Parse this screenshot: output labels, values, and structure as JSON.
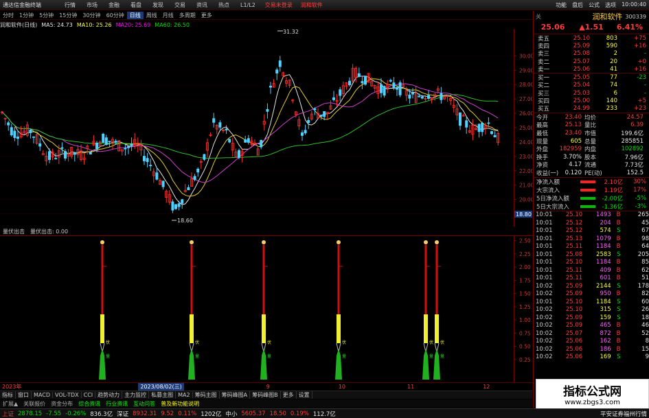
{
  "menubar": {
    "app_title": "通达信金融终端",
    "items": [
      "行情",
      "市场",
      "金融",
      "看盘",
      "发现",
      "交易",
      "资讯",
      "热点",
      "L1/L2"
    ],
    "login": "交易未登录",
    "login2": "润和软件",
    "right": [
      "功能",
      "盘后",
      "公式",
      "选项",
      "10:00:40"
    ]
  },
  "periods": [
    "分时",
    "1分钟",
    "5分钟",
    "15分钟",
    "30分钟",
    "60分钟",
    "日线",
    "周线",
    "月线",
    "多周期",
    "更多"
  ],
  "active_period": "日线",
  "ma": {
    "title": "润和软件(日线)",
    "ma5": "MA5: 24.73",
    "ma10": "MA10: 25.26",
    "ma20": "MA20: 25.69",
    "ma60": "MA60: 26.50"
  },
  "price_axis": [
    "30.00",
    "29.00",
    "28.00",
    "27.00",
    "26.00",
    "25.00",
    "24.00",
    "23.00",
    "22.00",
    "21.00",
    "20.00",
    "19.00"
  ],
  "price_marks": {
    "high": "31.32",
    "low": "18.60",
    "cursor": "18.80"
  },
  "sub": {
    "title": "量伏出击",
    "title2": "量伏出击: 0.00",
    "axis": [
      "2.50",
      "2.25",
      "2.00",
      "1.75",
      "1.50",
      "1.25",
      "1.00",
      "0.75",
      "0.50",
      "0.25"
    ]
  },
  "date_axis": {
    "year": "2023年",
    "selected": "2023/08/02(三)",
    "marks": [
      "7",
      "9",
      "10",
      "11",
      "12"
    ]
  },
  "chart_data": {
    "type": "candlestick",
    "signals": 6,
    "signal_labels": [
      "伏",
      "量"
    ]
  },
  "tabs": [
    "指标",
    "窗口",
    "MACD",
    "VOL-TDX",
    "CCI",
    "趋势动力",
    "主力监控",
    "私募主图",
    "MA2",
    "筹码主图",
    "筹码峰图A",
    "筹码峰图B",
    "更多",
    "设置"
  ],
  "bottom": [
    "扩展▲",
    "关联报价",
    "资金分布",
    "综合资讯",
    "行业资讯",
    "互动问答",
    "普及新功能说明"
  ],
  "status": {
    "sh_name": "上证",
    "sh_val": "2878.15",
    "sh_chg": "-7.55",
    "sh_pct": "-0.26%",
    "sh_amt": "836.3亿",
    "sz_name": "深证",
    "sz_val": "8932.31",
    "sz_chg": "9.52",
    "sz_pct": "0.11%",
    "sz_amt": "1202亿",
    "zx_name": "中小",
    "zx_val": "5605.37",
    "zx_chg": "18.50",
    "zx_pct": "0.19%",
    "zx_amt": "112.7亿",
    "broker": "平安证券福州行情"
  },
  "rp": {
    "hdr_left": "关",
    "name": "润和软件",
    "code": "300339",
    "price": "25.06",
    "chg": "▲1.51",
    "pct": "6.41%",
    "asks": [
      [
        "卖五",
        "25.10",
        "803",
        "+75"
      ],
      [
        "卖四",
        "25.09",
        "590",
        "+16"
      ],
      [
        "卖三",
        "25.08",
        "2",
        "-"
      ],
      [
        "卖二",
        "25.07",
        "20",
        "+0"
      ],
      [
        "卖一",
        "25.06",
        "41",
        "+16"
      ]
    ],
    "bids": [
      [
        "买一",
        "25.05",
        "77",
        "-23"
      ],
      [
        "买二",
        "25.04",
        "74",
        "-"
      ],
      [
        "买三",
        "25.03",
        "6",
        "-"
      ],
      [
        "买四",
        "25.00",
        "140",
        "+5"
      ],
      [
        "买五",
        "24.99",
        "233",
        "+23"
      ]
    ],
    "stats": [
      [
        "今开",
        "23.40",
        "均价",
        "24.57"
      ],
      [
        "最高",
        "25.13",
        "量比",
        "6.39"
      ],
      [
        "最低",
        "23.40",
        "市值",
        "199.6亿"
      ],
      [
        "现量",
        "605",
        "总量",
        "285851"
      ],
      [
        "外盘",
        "182959",
        "内盘",
        "102892"
      ],
      [
        "换手",
        "3.70%",
        "股本",
        "7.96亿"
      ],
      [
        "净资",
        "4.17",
        "流通",
        "7.73亿"
      ],
      [
        "收益(一)",
        "0.120",
        "PE(动)",
        "152.5"
      ]
    ],
    "flow": [
      [
        "净流入额",
        "2.10亿",
        "30%"
      ],
      [
        "大宗流入",
        "1.19亿",
        "17%"
      ],
      [
        "5日净流入额",
        "-2.00亿",
        "-5%"
      ],
      [
        "5日大宗流入",
        "-1.36亿",
        "-3%"
      ]
    ],
    "ticks": [
      [
        "10:01",
        "25.10",
        "1493",
        "B",
        "265"
      ],
      [
        "10:01",
        "25.12",
        "204",
        "B",
        "45"
      ],
      [
        "10:01",
        "25.12",
        "574",
        "S",
        "67"
      ],
      [
        "10:01",
        "25.13",
        "1079",
        "B",
        "98"
      ],
      [
        "10:01",
        "25.11",
        "1184",
        "B",
        "64"
      ],
      [
        "10:01",
        "25.08",
        "2583",
        "S",
        "205"
      ],
      [
        "10:01",
        "25.10",
        "1184",
        "B",
        "85"
      ],
      [
        "10:01",
        "25.11",
        "409",
        "B",
        "62"
      ],
      [
        "10:01",
        "25.11",
        "601",
        "B",
        "51"
      ],
      [
        "10:02",
        "25.09",
        "2144",
        "S",
        "178"
      ],
      [
        "10:02",
        "25.09",
        "950",
        "B",
        "82"
      ],
      [
        "10:01",
        "25.10",
        "1184",
        "S",
        "60"
      ],
      [
        "10:02",
        "25.10",
        "315",
        "S",
        "26"
      ],
      [
        "10:02",
        "25.09",
        "159",
        "S",
        "18"
      ],
      [
        "10:02",
        "25.09",
        "465",
        "B",
        "46"
      ],
      [
        "10:02",
        "25.07",
        "872",
        "B",
        "52"
      ],
      [
        "10:02",
        "25.06",
        "162",
        "B",
        "8"
      ],
      [
        "10:02",
        "25.06",
        "186",
        "B",
        "15"
      ],
      [
        "10:02",
        "25.06",
        "169",
        "S",
        "9"
      ]
    ]
  },
  "watermark": {
    "line1": "指标公式网",
    "line2": "www.zbgs3.com"
  }
}
